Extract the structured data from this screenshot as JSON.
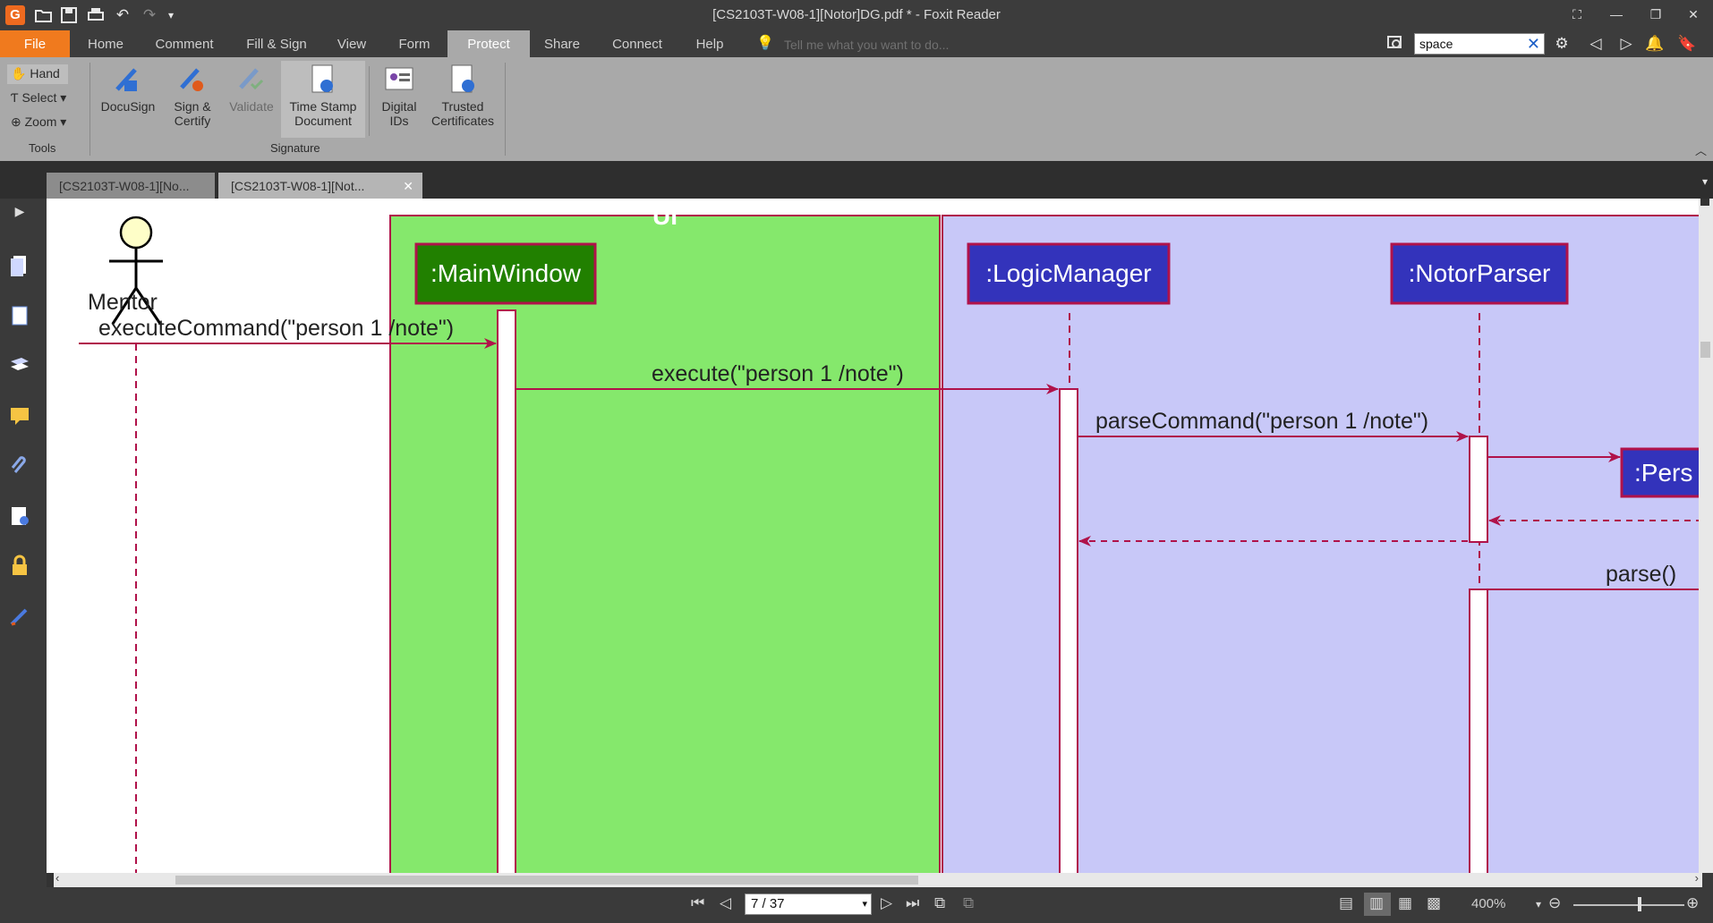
{
  "window": {
    "title": "[CS2103T-W08-1][Notor]DG.pdf * - Foxit Reader",
    "app_icon": "G"
  },
  "menu": {
    "items": [
      "File",
      "Home",
      "Comment",
      "Fill & Sign",
      "View",
      "Form",
      "Protect",
      "Share",
      "Connect",
      "Help"
    ],
    "active": "Protect",
    "tell_me_placeholder": "Tell me what you want to do...",
    "search_value": "space"
  },
  "ribbon": {
    "tools": {
      "hand": "Hand",
      "select": "Select",
      "zoom": "Zoom",
      "group_label": "Tools"
    },
    "signature": {
      "docusign": "DocuSign",
      "sign_certify_1": "Sign &",
      "sign_certify_2": "Certify",
      "validate": "Validate",
      "timestamp_1": "Time Stamp",
      "timestamp_2": "Document",
      "digital_1": "Digital",
      "digital_2": "IDs",
      "trusted_1": "Trusted",
      "trusted_2": "Certificates",
      "group_label": "Signature"
    }
  },
  "tabs": [
    {
      "label": "[CS2103T-W08-1][No..."
    },
    {
      "label": "[CS2103T-W08-1][Not..."
    }
  ],
  "diagram": {
    "actor": "Mentor",
    "ui_box": "UI",
    "mainwindow": ":MainWindow",
    "logicmanager": ":LogicManager",
    "notorparser": ":NotorParser",
    "person": ":Pers",
    "msg1": "executeCommand(\"person 1 /note\")",
    "msg2": "execute(\"person 1 /note\")",
    "msg3": "parseCommand(\"person 1 /note\")",
    "msg4": "parse()"
  },
  "status": {
    "page": "7 / 37",
    "zoom": "400%"
  },
  "colors": {
    "accent_orange": "#f07a1e",
    "ui_box": "#85e86c",
    "logic_box": "#c8c8f8",
    "crimson": "#b0124a",
    "mainwindow_fill": "#218000",
    "blue_fill": "#3333bb"
  }
}
